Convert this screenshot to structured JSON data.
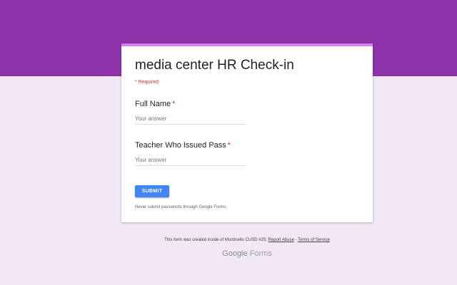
{
  "colors": {
    "header_band": "#8d33aa",
    "background": "#f2e7f5",
    "card_accent": "#d580ee",
    "required": "#d32f2f",
    "submit_button": "#4285f4"
  },
  "form": {
    "title": "media center HR Check-in",
    "required_note": "* Required",
    "questions": [
      {
        "label": "Full Name",
        "required_mark": "*",
        "placeholder": "Your answer",
        "value": ""
      },
      {
        "label": "Teacher Who Issued Pass",
        "required_mark": "*",
        "placeholder": "Your answer",
        "value": ""
      }
    ],
    "submit_label": "SUBMIT",
    "password_note": "Never submit passwords through Google Forms."
  },
  "footer": {
    "created_text": "This form was created inside of Monticello CUSD #25.",
    "report_abuse": "Report Abuse",
    "separator": " - ",
    "terms": "Terms of Service",
    "brand_google": "Google",
    "brand_forms": "Forms"
  }
}
